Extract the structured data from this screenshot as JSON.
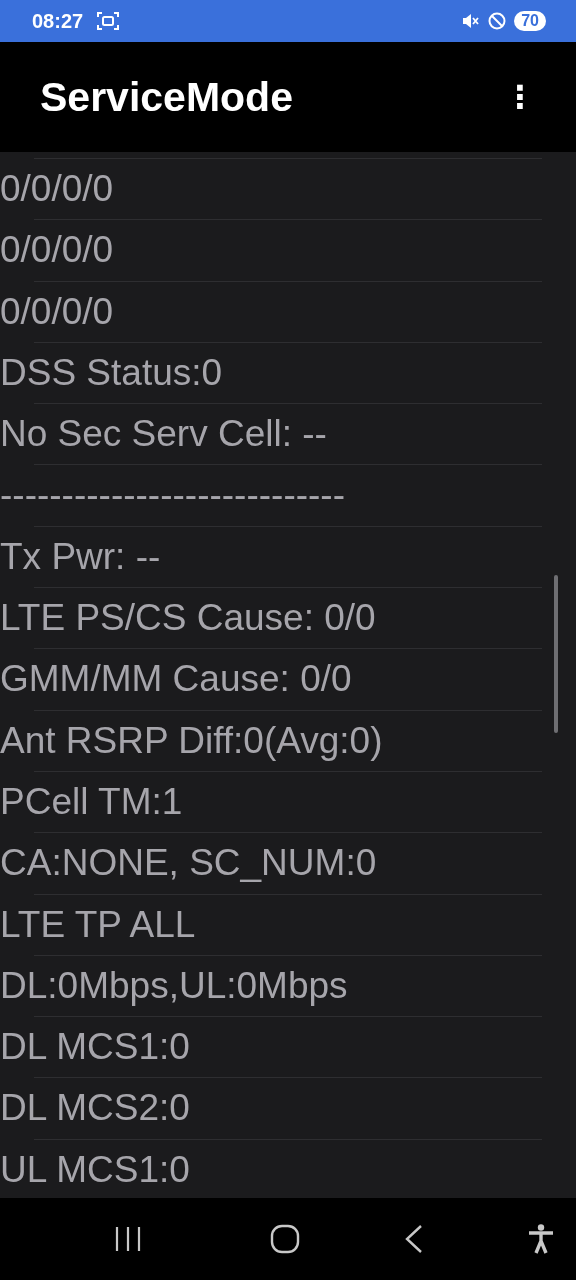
{
  "status_bar": {
    "time": "08:27",
    "battery": "70"
  },
  "app_bar": {
    "title": "ServiceMode",
    "menu": "⋮"
  },
  "lines": [
    "0/0/0/0",
    "0/0/0/0",
    "0/0/0/0",
    "DSS Status:0",
    "No Sec Serv Cell: --",
    "----------------------------",
    "Tx Pwr: --",
    "LTE PS/CS Cause: 0/0",
    "GMM/MM Cause: 0/0",
    "Ant RSRP Diff:0(Avg:0)",
    "PCell TM:1",
    "CA:NONE, SC_NUM:0",
    "LTE TP ALL",
    "DL:0Mbps,UL:0Mbps",
    "DL MCS1:0",
    "DL MCS2:0",
    "UL MCS1:0"
  ]
}
